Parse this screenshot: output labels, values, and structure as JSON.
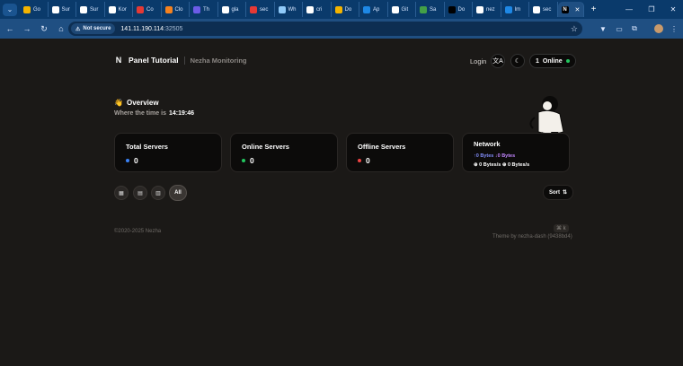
{
  "browser": {
    "tabs": [
      {
        "label": "Go",
        "color": "#f4b400"
      },
      {
        "label": "Sur",
        "color": "#ffffff"
      },
      {
        "label": "Sur",
        "color": "#ffffff"
      },
      {
        "label": "Kor",
        "color": "#ffffff"
      },
      {
        "label": "Co",
        "color": "#e53935"
      },
      {
        "label": "Clo",
        "color": "#f6821f"
      },
      {
        "label": "Th",
        "color": "#6c5ce7"
      },
      {
        "label": "gla",
        "color": "#ffffff"
      },
      {
        "label": "sec",
        "color": "#e53935"
      },
      {
        "label": "Wh",
        "color": "#90caf9"
      },
      {
        "label": "cri",
        "color": "#ffffff"
      },
      {
        "label": "Do",
        "color": "#f4b400"
      },
      {
        "label": "Ap",
        "color": "#1e88e5"
      },
      {
        "label": "Git",
        "color": "#ffffff"
      },
      {
        "label": "Sa",
        "color": "#43a047"
      },
      {
        "label": "Do",
        "color": "#000000"
      },
      {
        "label": "nez",
        "color": "#ffffff"
      },
      {
        "label": "Im",
        "color": "#1e88e5"
      },
      {
        "label": "sec",
        "color": "#ffffff"
      }
    ],
    "active_tab_icon": "N",
    "close_glyph": "✕",
    "new_tab": "+",
    "window_controls": [
      "—",
      "❐",
      "✕"
    ],
    "not_secure_label": "Not secure",
    "url_host": "141.11.190.114",
    "url_port": ":32505"
  },
  "header": {
    "logo": "N",
    "title": "Panel Tutorial",
    "subtitle": "Nezha Monitoring",
    "login": "Login",
    "online_count": "1",
    "online_label": "Online"
  },
  "overview": {
    "emoji": "👋",
    "title": "Overview",
    "time_prefix": "Where the time is",
    "time": "14:19:46"
  },
  "cards": {
    "total": {
      "title": "Total Servers",
      "value": "0",
      "dot_color": "#3b82f6"
    },
    "online": {
      "title": "Online Servers",
      "value": "0",
      "dot_color": "#22c55e"
    },
    "offline": {
      "title": "Offline Servers",
      "value": "0",
      "dot_color": "#ef4444"
    },
    "network": {
      "title": "Network",
      "up": "↑0 Bytes",
      "down": "↓0 Bytes",
      "up_speed": "0 Bytes/s",
      "down_speed": "0 Bytes/s"
    }
  },
  "filters": {
    "all_label": "All",
    "sort_label": "Sort",
    "sort_icon": "⇅"
  },
  "footer": {
    "copyright": "©2020-2025 Nezha",
    "shortcut": "⌘ k",
    "theme": "Theme by nezha-dash (9438bd4)"
  }
}
